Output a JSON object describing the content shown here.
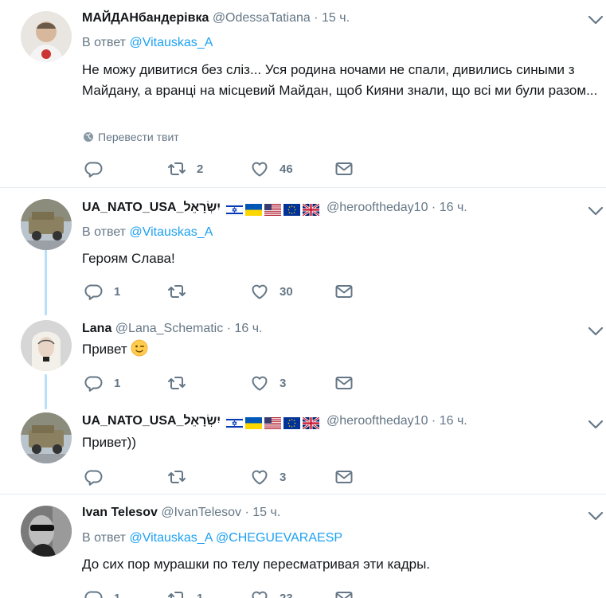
{
  "tweets": [
    {
      "name": "МАЙДАНбандерівка",
      "handle": "@OdessaTatiana",
      "time": "15 ч.",
      "reply_prefix": "В ответ",
      "reply_to": "@Vitauskas_A",
      "text": "Не можу дивитися без сліз... Уся родина ночами не спали, дивились сиными з Майдану, а вранці на місцевий Майдан, щоб Кияни знали, що всі ми були разом...",
      "translate": "Перевести твит",
      "replies": "",
      "retweets": "2",
      "likes": "46"
    },
    {
      "name": "UA_NATO_USA_יִשְׂרָאֵל",
      "handle": "@herooftheday10",
      "time": "16 ч.",
      "reply_prefix": "В ответ",
      "reply_to": "@Vitauskas_A",
      "text": "Героям Слава!",
      "replies": "1",
      "retweets": "",
      "likes": "30",
      "flags": [
        "israel-flag",
        "ukraine-flag",
        "usa-flag",
        "eu-flag",
        "uk-flag"
      ]
    },
    {
      "name": "Lana",
      "handle": "@Lana_Schematic",
      "time": "16 ч.",
      "text": "Привет",
      "emoji": "winking-face-emoji",
      "replies": "1",
      "retweets": "",
      "likes": "3"
    },
    {
      "name": "UA_NATO_USA_יִשְׂרָאֵל",
      "handle": "@herooftheday10",
      "time": "16 ч.",
      "text": "Привет))",
      "replies": "",
      "retweets": "",
      "likes": "3",
      "flags": [
        "israel-flag",
        "ukraine-flag",
        "usa-flag",
        "eu-flag",
        "uk-flag"
      ]
    },
    {
      "name": "Ivan Telesov",
      "handle": "@IvanTelesov",
      "time": "15 ч.",
      "reply_prefix": "В ответ",
      "reply_to": "@Vitauskas_A",
      "reply_to_2": "@CHEGUEVARAESP",
      "text": "До сих пор мурашки по телу пересматривая эти кадры.",
      "replies": "1",
      "retweets": "1",
      "likes": "23"
    }
  ],
  "colors": {
    "link": "#1da1f2",
    "muted": "#657786",
    "text": "#14171a",
    "thread_line": "#b5e0f7",
    "divider": "#e6ecf0"
  },
  "dot": "·"
}
